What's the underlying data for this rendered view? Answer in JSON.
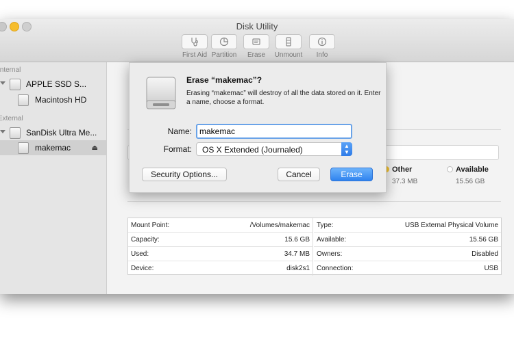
{
  "window": {
    "title": "Disk Utility"
  },
  "toolbar": {
    "items": [
      {
        "label": "First Aid",
        "icon": "stethoscope-icon"
      },
      {
        "label": "Partition",
        "icon": "pie-chart-icon"
      },
      {
        "label": "Erase",
        "icon": "erase-icon"
      },
      {
        "label": "Unmount",
        "icon": "unmount-icon"
      },
      {
        "label": "Info",
        "icon": "info-icon"
      }
    ]
  },
  "sidebar": {
    "internal_header": "Internal",
    "external_header": "External",
    "items": [
      {
        "label": "APPLE SSD S..."
      },
      {
        "label": "Macintosh HD"
      },
      {
        "label": "SanDisk Ultra Me..."
      },
      {
        "label": "makemac"
      }
    ],
    "eject_icon": "⏏"
  },
  "usage": {
    "other_name": "Other",
    "other_value": "37.3 MB",
    "available_name": "Available",
    "available_value": "15.56 GB",
    "colors": {
      "other": "#f6c431",
      "available": "#ffffff",
      "used": "#3d8ff0"
    }
  },
  "info": {
    "left": [
      {
        "key": "Mount Point:",
        "value": "/Volumes/makemac"
      },
      {
        "key": "Capacity:",
        "value": "15.6 GB"
      },
      {
        "key": "Used:",
        "value": "34.7 MB"
      },
      {
        "key": "Device:",
        "value": "disk2s1"
      }
    ],
    "right": [
      {
        "key": "Type:",
        "value": "USB External Physical Volume"
      },
      {
        "key": "Available:",
        "value": "15.56 GB"
      },
      {
        "key": "Owners:",
        "value": "Disabled"
      },
      {
        "key": "Connection:",
        "value": "USB"
      }
    ]
  },
  "dialog": {
    "title": "Erase “makemac”?",
    "message": "Erasing “makemac” will destroy of all the data stored on it. Enter a name, choose a format.",
    "name_label": "Name:",
    "name_value": "makemac",
    "format_label": "Format:",
    "format_value": "OS X Extended (Journaled)",
    "security_button": "Security Options...",
    "cancel_button": "Cancel",
    "erase_button": "Erase",
    "accent": "#2f83ef"
  }
}
